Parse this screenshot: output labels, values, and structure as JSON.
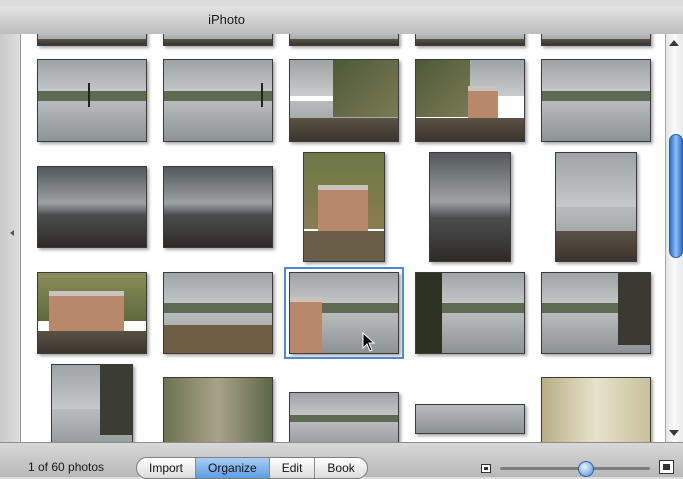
{
  "window": {
    "title": "iPhoto"
  },
  "status": {
    "count": "1 of 60 photos"
  },
  "toolbar": {
    "buttons": [
      {
        "label": "Import",
        "active": false
      },
      {
        "label": "Organize",
        "active": true
      },
      {
        "label": "Edit",
        "active": false
      },
      {
        "label": "Book",
        "active": false
      }
    ]
  },
  "zoom": {
    "level": 0.57
  },
  "selection": {
    "selected_index": 12
  },
  "icons": [
    "small-photo-icon",
    "large-photo-icon",
    "scroll-up-icon",
    "scroll-down-icon",
    "pointer-cursor-icon"
  ],
  "colors": {
    "accent": "#4d8ad6",
    "active_segment": "#5d9de4"
  }
}
